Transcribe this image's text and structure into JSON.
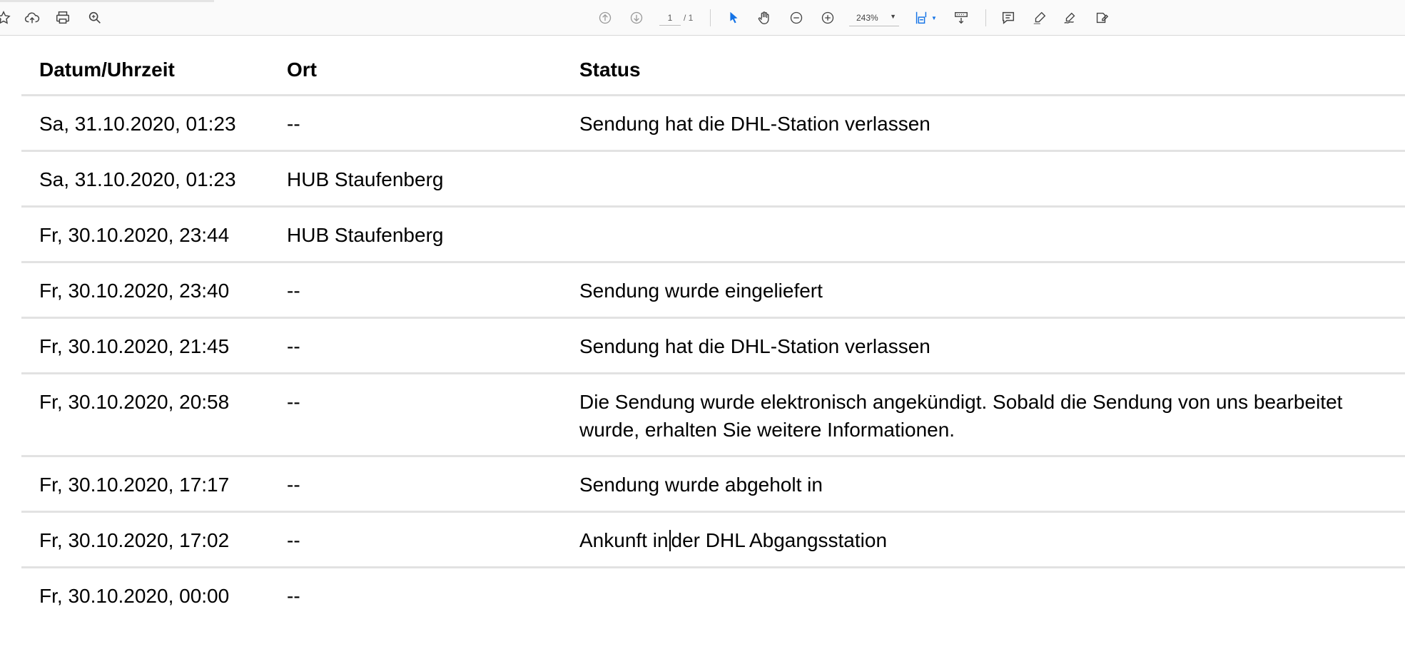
{
  "toolbar": {
    "page_current": "1",
    "page_total": "/ 1",
    "zoom": "243%",
    "accent_color": "#1473e6"
  },
  "table": {
    "headers": {
      "date": "Datum/Uhrzeit",
      "ort": "Ort",
      "status": "Status"
    },
    "rows": [
      {
        "date": "Sa, 31.10.2020, 01:23",
        "ort": "--",
        "status": "Sendung hat die DHL-Station verlassen"
      },
      {
        "date": "Sa, 31.10.2020, 01:23",
        "ort": "HUB Staufenberg",
        "status": ""
      },
      {
        "date": "Fr, 30.10.2020, 23:44",
        "ort": "HUB Staufenberg",
        "status": ""
      },
      {
        "date": "Fr, 30.10.2020, 23:40",
        "ort": "--",
        "status": "Sendung wurde eingeliefert"
      },
      {
        "date": "Fr, 30.10.2020, 21:45",
        "ort": "--",
        "status": "Sendung hat die DHL-Station verlassen"
      },
      {
        "date": "Fr, 30.10.2020, 20:58",
        "ort": "--",
        "status_line1": "Die Sendung wurde elektronisch angekündigt. Sobald die Sendung von uns bearbeitet",
        "status_line2": "wurde, erhalten Sie weitere Informationen."
      },
      {
        "date": "Fr, 30.10.2020, 17:17",
        "ort": "--",
        "status": "Sendung wurde abgeholt in"
      },
      {
        "date": "Fr, 30.10.2020, 17:02",
        "ort": "--",
        "status_a": "Ankunft in",
        "status_b": "der DHL Abgangsstation"
      },
      {
        "date": "Fr, 30.10.2020, 00:00",
        "ort": "--",
        "status": ""
      }
    ]
  }
}
